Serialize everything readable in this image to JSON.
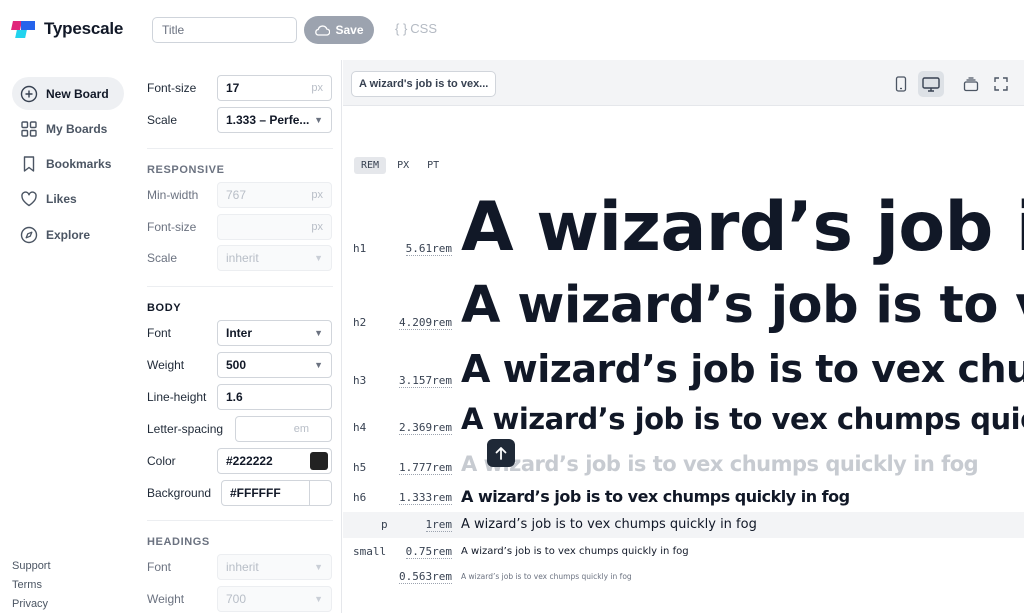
{
  "app": {
    "name": "Typescale"
  },
  "header": {
    "title_placeholder": "Title",
    "save_label": "Save",
    "css_label": "CSS"
  },
  "nav": {
    "items": [
      {
        "label": "New Board",
        "icon": "plus-circle-icon",
        "active": true
      },
      {
        "label": "My Boards",
        "icon": "grid-icon",
        "active": false
      },
      {
        "label": "Bookmarks",
        "icon": "bookmark-icon",
        "active": false
      },
      {
        "label": "Likes",
        "icon": "heart-icon",
        "active": false
      },
      {
        "label": "Explore",
        "icon": "compass-icon",
        "active": false
      }
    ],
    "footer": [
      "Support",
      "Terms",
      "Privacy"
    ]
  },
  "settings": {
    "font_size_label": "Font-size",
    "font_size_value": "17",
    "font_size_unit": "px",
    "scale_label": "Scale",
    "scale_value": "1.333 – Perfe...",
    "responsive": {
      "heading": "RESPONSIVE",
      "min_width_label": "Min-width",
      "min_width_value": "767",
      "min_width_unit": "px",
      "font_size_label": "Font-size",
      "font_size_unit": "px",
      "scale_label": "Scale",
      "scale_value": "inherit"
    },
    "body": {
      "heading": "BODY",
      "font_label": "Font",
      "font_value": "Inter",
      "weight_label": "Weight",
      "weight_value": "500",
      "line_height_label": "Line-height",
      "line_height_value": "1.6",
      "letter_spacing_label": "Letter-spacing",
      "letter_spacing_unit": "em",
      "color_label": "Color",
      "color_value": "#222222",
      "background_label": "Background",
      "background_value": "#FFFFFF"
    },
    "headings": {
      "heading": "HEADINGS",
      "font_label": "Font",
      "font_value": "inherit",
      "weight_label": "Weight",
      "weight_value": "700"
    }
  },
  "preview": {
    "sample_text": "A wizard's job is to vex...",
    "units": [
      "REM",
      "PX",
      "PT"
    ],
    "active_unit": "REM",
    "rows": [
      {
        "tag": "h1",
        "size": "5.61rem",
        "text": "A wizard’s job is to vex chumps quickly in fog"
      },
      {
        "tag": "h2",
        "size": "4.209rem",
        "text": "A wizard’s job is to vex chumps quickly in fog"
      },
      {
        "tag": "h3",
        "size": "3.157rem",
        "text": "A wizard’s job is to vex chumps quickly in fog"
      },
      {
        "tag": "h4",
        "size": "2.369rem",
        "text": "A wizard’s job is to vex chumps quickly in fog"
      },
      {
        "tag": "h5",
        "size": "1.777rem",
        "text": "A wizard’s job is to vex chumps quickly in fog"
      },
      {
        "tag": "h6",
        "size": "1.333rem",
        "text": "A wizard’s job is to vex chumps quickly in fog"
      },
      {
        "tag": "p",
        "size": "1rem",
        "text": "A wizard’s job is to vex chumps quickly in fog"
      },
      {
        "tag": "small",
        "size": "0.75rem",
        "text": "A wizard’s job is to vex chumps quickly in fog"
      },
      {
        "tag": "",
        "size": "0.563rem",
        "text": "A wizard’s job is to vex chumps quickly in fog"
      }
    ]
  },
  "colors": {
    "text": "#111827",
    "muted": "#6b7280",
    "save_bg": "#9ca3af",
    "swatch_dark": "#222222"
  }
}
